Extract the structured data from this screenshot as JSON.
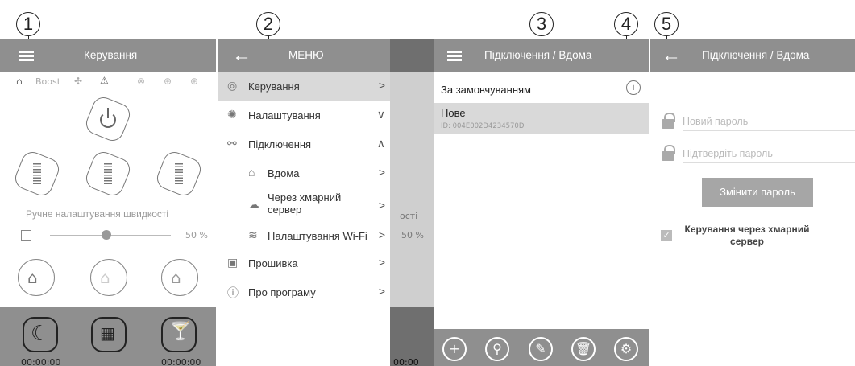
{
  "callouts": [
    "1",
    "2",
    "3",
    "4",
    "5"
  ],
  "screen1": {
    "title": "Керування",
    "status_boost": "Boost",
    "manual_speed_label": "Ручне налаштування швидкості",
    "speed_percent": "50 %",
    "speed_value": 0.5,
    "timers": [
      "00:00:00",
      "00:00:00"
    ]
  },
  "screen2": {
    "title": "МЕНЮ",
    "bg_peek": {
      "label_fragment": "ості",
      "percent": "50 %",
      "timer": "00:00"
    },
    "menu": [
      {
        "label": "Керування",
        "icon": "fan-icon",
        "chevron": ">"
      },
      {
        "label": "Налаштування",
        "icon": "settings-icon",
        "chevron": "∨"
      },
      {
        "label": "Підключення",
        "icon": "share-icon",
        "chevron": "∧"
      },
      {
        "label": "Вдома",
        "icon": "home-icon",
        "chevron": ">"
      },
      {
        "label": "Через хмарний сервер",
        "icon": "cloud-icon",
        "chevron": ">"
      },
      {
        "label": "Налаштування Wi-Fi",
        "icon": "wifi-icon",
        "chevron": ">"
      },
      {
        "label": "Прошивка",
        "icon": "firmware-icon",
        "chevron": ">"
      },
      {
        "label": "Про програму",
        "icon": "info-icon",
        "chevron": ">"
      }
    ]
  },
  "screen3": {
    "title": "Підключення / Вдома",
    "default_label": "За замовчуванням",
    "device_name": "Нове",
    "device_id": "ID: 004E002D4234570D",
    "toolbar": [
      "add-icon",
      "search-icon",
      "edit-icon",
      "delete-icon",
      "gear-icon"
    ]
  },
  "screen4": {
    "title": "Підключення / Вдома",
    "new_password_placeholder": "Новий пароль",
    "confirm_password_placeholder": "Підтвердіть пароль",
    "change_password_button": "Змінити пароль",
    "cloud_control_label": "Керування через хмарний сервер",
    "cloud_control_checked": true
  },
  "colors": {
    "appbar": "#8f8f8f",
    "selected_row": "#d9d9d9",
    "button": "#a6a6a6",
    "toolbar": "#8f8f8f"
  }
}
